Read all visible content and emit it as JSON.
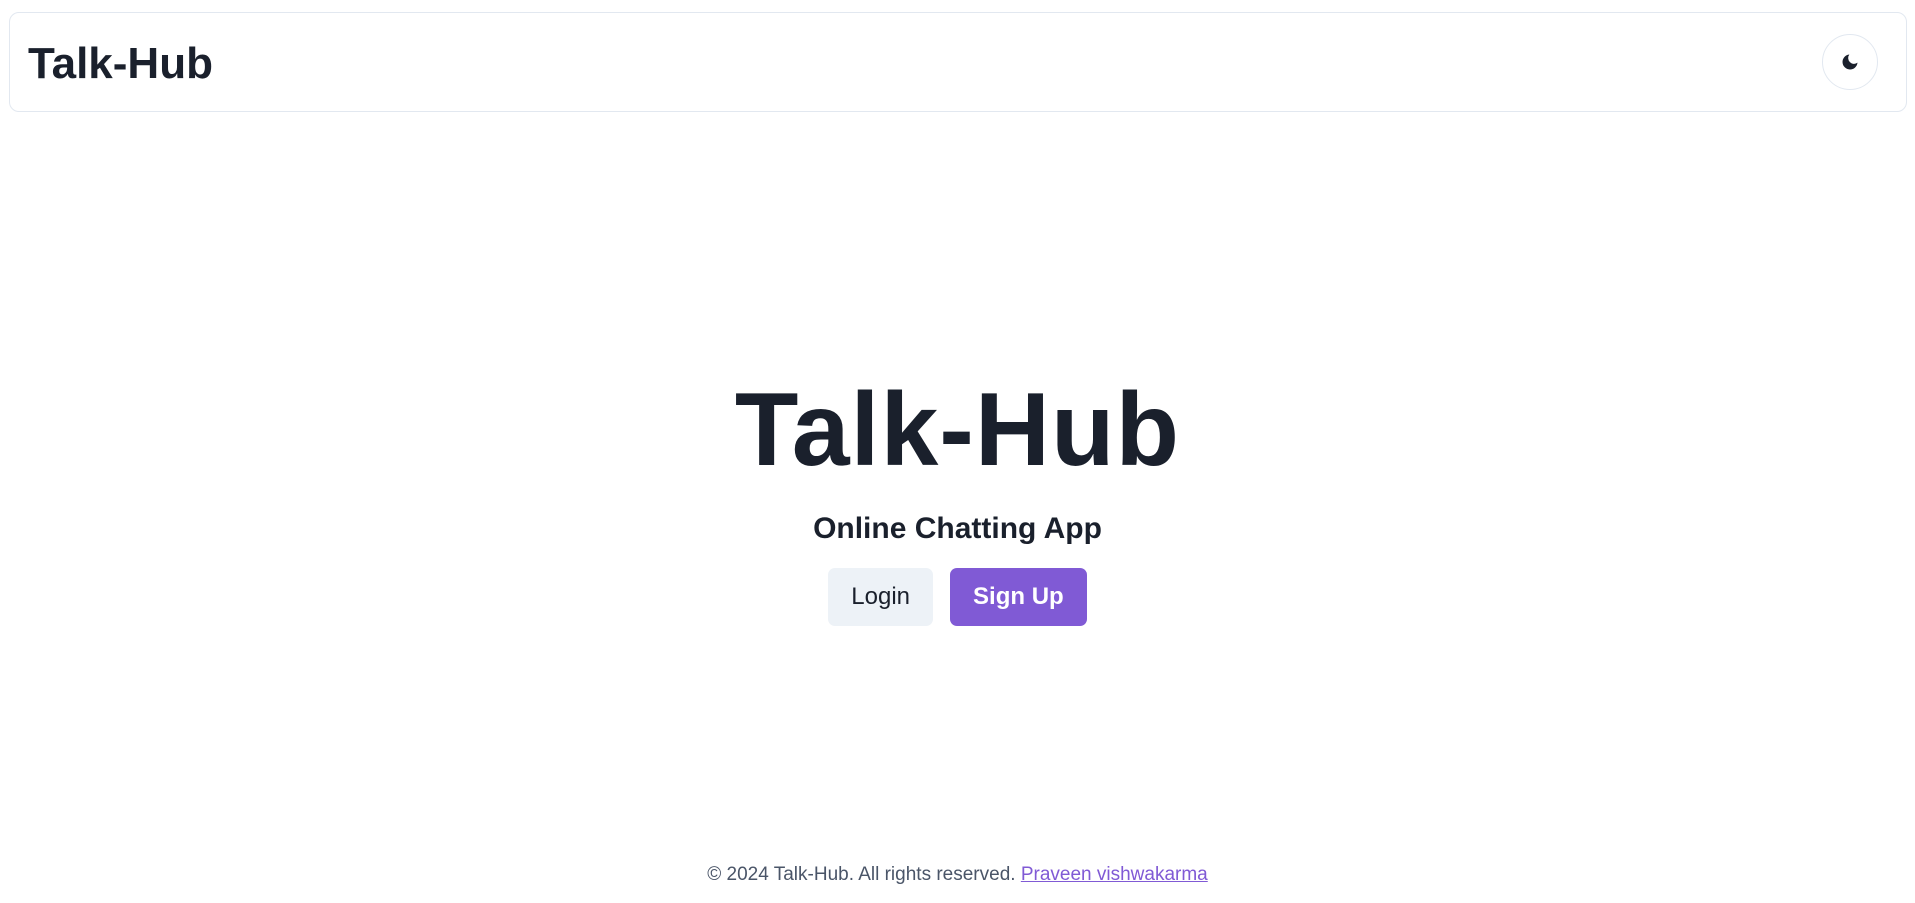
{
  "nav": {
    "title": "Talk-Hub",
    "theme_toggle_icon": "moon-icon"
  },
  "hero": {
    "title": "Talk-Hub",
    "subtitle": "Online Chatting App",
    "login_label": "Login",
    "signup_label": "Sign Up"
  },
  "footer": {
    "copyright": "© 2024 Talk-Hub. All rights reserved.",
    "author_link": "Praveen vishwakarma"
  },
  "colors": {
    "accent": "#805ad5",
    "text": "#1a202c",
    "button_secondary_bg": "#edf2f7",
    "border": "#e2e8f0"
  }
}
